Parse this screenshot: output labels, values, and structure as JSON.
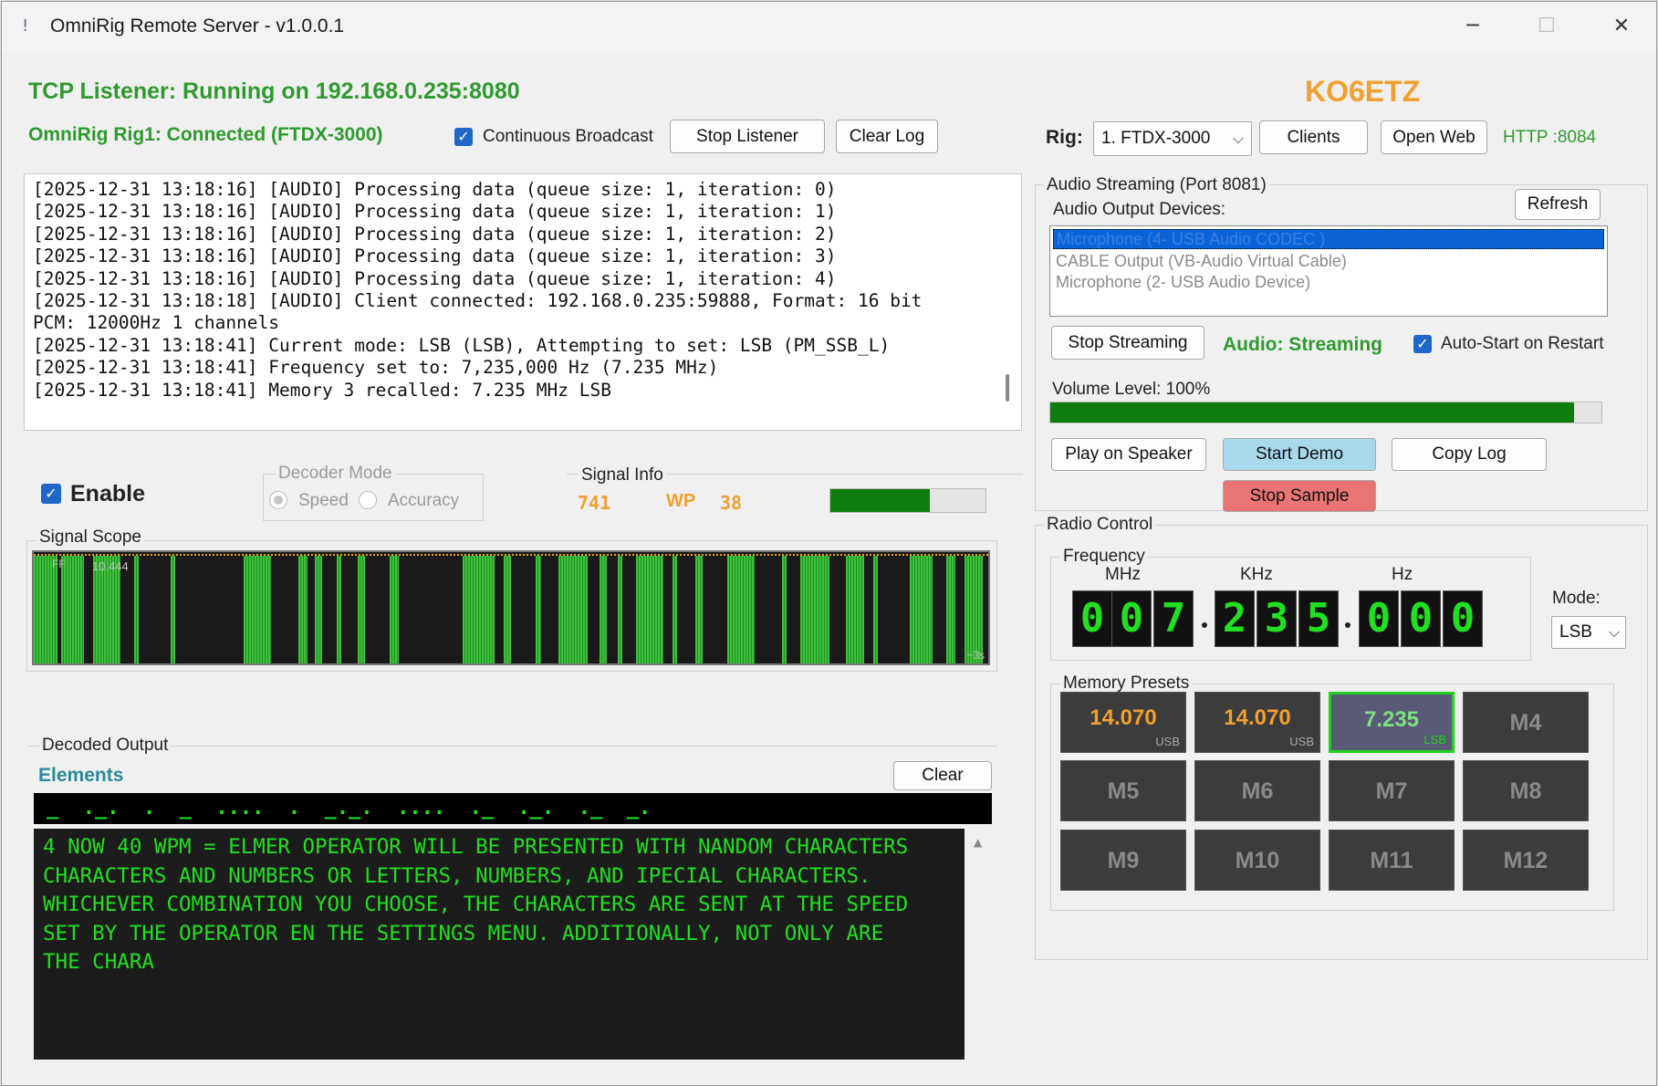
{
  "window": {
    "title": "OmniRig Remote Server - v1.0.0.1",
    "icon": "exclamation-app-icon",
    "controls": {
      "minimize": "─",
      "maximize": "☐",
      "close": "✕"
    }
  },
  "status": {
    "tcp": "TCP Listener: Running on 192.168.0.235:8080",
    "rig": "OmniRig Rig1: Connected (FTDX-3000)",
    "callsign": "KO6ETZ"
  },
  "toolbar": {
    "continuous_broadcast": "Continuous Broadcast",
    "continuous_broadcast_checked": true,
    "stop_listener": "Stop Listener",
    "clear_log": "Clear Log",
    "rig_label": "Rig:",
    "rig_value": "1. FTDX-3000",
    "clients": "Clients",
    "open_web": "Open Web",
    "http": "HTTP :8084"
  },
  "log": {
    "lines": [
      "[2025-12-31 13:18:16] [AUDIO] Processing data (queue size: 1, iteration: 0)",
      "[2025-12-31 13:18:16] [AUDIO] Processing data (queue size: 1, iteration: 1)",
      "[2025-12-31 13:18:16] [AUDIO] Processing data (queue size: 1, iteration: 2)",
      "[2025-12-31 13:18:16] [AUDIO] Processing data (queue size: 1, iteration: 3)",
      "[2025-12-31 13:18:16] [AUDIO] Processing data (queue size: 1, iteration: 4)",
      "[2025-12-31 13:18:18] [AUDIO] Client connected: 192.168.0.235:59888, Format: 16 bit",
      "PCM: 12000Hz 1 channels",
      "[2025-12-31 13:18:41] Current mode: LSB (LSB), Attempting to set: LSB (PM_SSB_L)",
      "[2025-12-31 13:18:41] Frequency set to: 7,235,000 Hz (7.235 MHz)",
      "[2025-12-31 13:18:41] Memory 3 recalled: 7.235 MHz LSB"
    ]
  },
  "decoder": {
    "enable_label": "Enable",
    "enable_checked": true,
    "mode_group": "Decoder Mode",
    "speed": "Speed",
    "accuracy": "Accuracy",
    "signal_info_group": "Signal Info",
    "signal_value": "741",
    "wp_label": "WP",
    "wp_value": "38",
    "signal_level": 0.64,
    "scope_title": "Signal Scope",
    "scope_ff": "FF",
    "scope_value": "10.444",
    "scope_time": "~3s",
    "output_group": "Decoded Output",
    "elements_label": "Elements",
    "clear": "Clear",
    "elements_text": "_  ._.  .  _  ....  .  _._.  ....  ._  ._.  ._  _.",
    "decoded_text": "4 NOW 40 WPM = ELMER OPERATOR WILL BE PRESENTED WITH NANDOM CHARACTERS\nCHARACTERS AND NUMBERS OR LETTERS, NUMBERS, AND IPECIAL CHARACTERS.\nWHICHEVER COMBINATION YOU CHOOSE, THE CHARACTERS ARE SENT AT THE SPEED\nSET BY THE OPERATOR EN THE SETTINGS MENU. ADDITIONALLY, NOT ONLY ARE\nTHE CHARA"
  },
  "audio": {
    "group": "Audio Streaming (Port 8081)",
    "devices_label": "Audio Output Devices:",
    "refresh": "Refresh",
    "devices": [
      "Microphone (4- USB Audio CODEC )",
      "CABLE Output (VB-Audio Virtual Cable)",
      "Microphone (2- USB Audio Device)"
    ],
    "selected_device": 0,
    "stop_streaming": "Stop Streaming",
    "status": "Audio: Streaming",
    "auto_start": "Auto-Start on Restart",
    "auto_start_checked": true,
    "volume_label": "Volume Level: 100%",
    "volume_level": 0.95,
    "play_on_speaker": "Play on Speaker",
    "start_demo": "Start Demo",
    "copy_log": "Copy Log",
    "stop_sample": "Stop Sample"
  },
  "radio": {
    "group": "Radio Control",
    "frequency_group": "Frequency",
    "mhz": "MHz",
    "khz": "KHz",
    "hz": "Hz",
    "digits": [
      "0",
      "0",
      "7",
      "2",
      "3",
      "5",
      "0",
      "0",
      "0"
    ],
    "mode_label": "Mode:",
    "mode_value": "LSB",
    "presets_group": "Memory Presets",
    "presets": [
      {
        "freq": "14.070",
        "mode": "USB"
      },
      {
        "freq": "14.070",
        "mode": "USB"
      },
      {
        "freq": "7.235",
        "mode": "LSB",
        "active": true
      },
      {
        "name": "M4"
      },
      {
        "name": "M5"
      },
      {
        "name": "M6"
      },
      {
        "name": "M7"
      },
      {
        "name": "M8"
      },
      {
        "name": "M9"
      },
      {
        "name": "M10"
      },
      {
        "name": "M11"
      },
      {
        "name": "M12"
      }
    ]
  },
  "colors": {
    "accent_green": "#2e9a2e",
    "callsign_orange": "#f0a030",
    "digit_green": "#21e021",
    "demo_blue": "#a8d8ec",
    "sample_red": "#e87474"
  }
}
